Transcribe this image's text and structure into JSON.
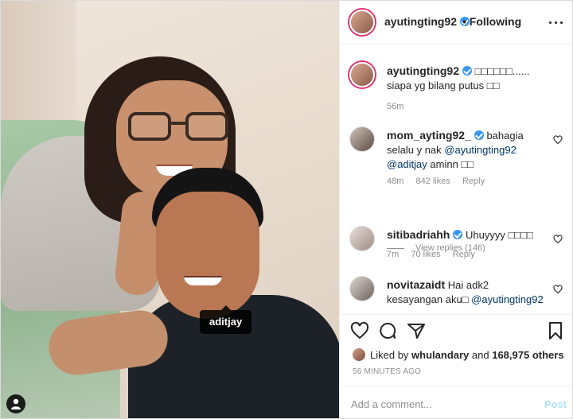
{
  "post": {
    "owner": "ayutingting92",
    "follow_status": "Following",
    "photo_tag": "aditjay"
  },
  "caption": {
    "username": "ayutingting92",
    "text": "□□□□□□...... siapa yg bilang putus □□",
    "time": "56m"
  },
  "comments": [
    {
      "username": "mom_ayting92_",
      "text_before": "bahagia selalu y nak ",
      "mentions": "@ayutingting92 @aditjay",
      "text_after": " aminn □□",
      "time": "48m",
      "likes": "842 likes",
      "reply": "Reply"
    },
    {
      "username": "sitibadriahh",
      "text": "Uhuyyyy □□□□",
      "time": "7m",
      "likes": "70 likes",
      "reply": "Reply"
    },
    {
      "username": "novitazaidt",
      "text_before": "Hai adk2 kesayangan aku□ ",
      "mentions": "@ayutingting92"
    }
  ],
  "view_replies": "View replies (146)",
  "likes": {
    "prefix": "Liked by ",
    "user": "whulandary",
    "middle": " and ",
    "count": "168,975 others"
  },
  "timestamp": "56 MINUTES AGO",
  "add_comment": {
    "placeholder": "Add a comment...",
    "post_label": "Post"
  },
  "icons": [
    "more-icon",
    "heart-icon",
    "comment-icon",
    "share-icon",
    "bookmark-icon",
    "user-tag-icon",
    "verified-icon"
  ],
  "colors": {
    "verified": "#3897f0",
    "mention": "#00376b",
    "meta": "#8e8e8e",
    "post_disabled": "#b2dffc"
  }
}
